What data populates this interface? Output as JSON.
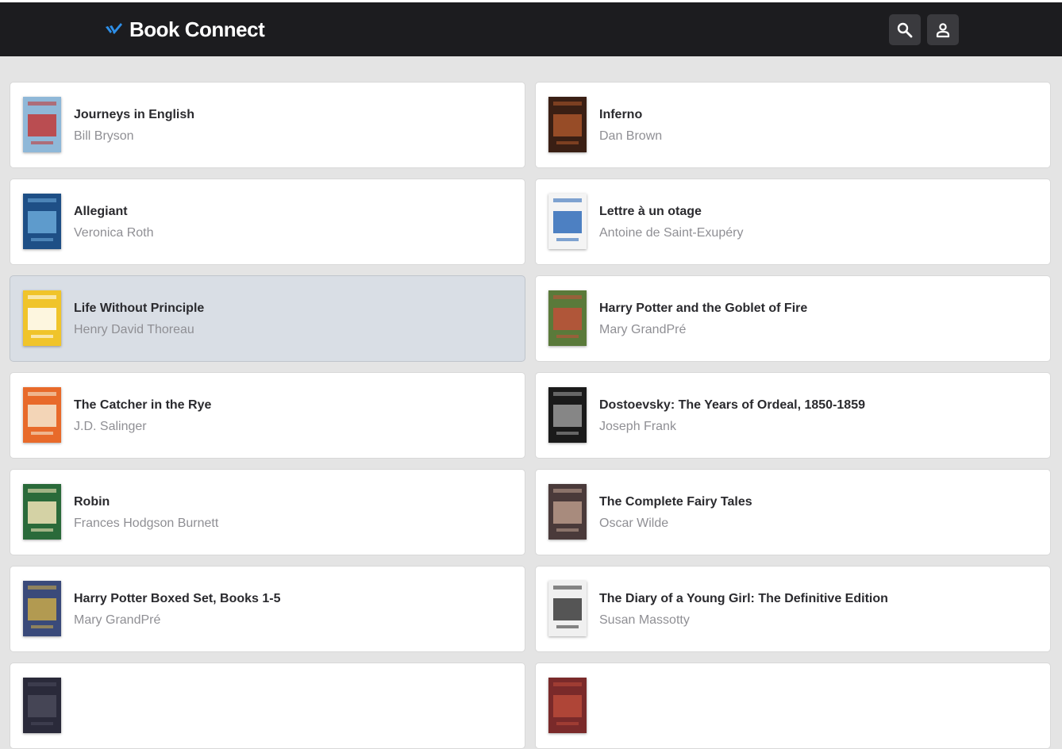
{
  "header": {
    "app_name": "Book Connect",
    "brand_color": "#1c1c1f",
    "logo_color": "#2e8fe8",
    "search_icon": "search-icon",
    "account_icon": "account-icon"
  },
  "books": [
    {
      "title": "Journeys in English",
      "author": "Bill Bryson",
      "cover_colors": [
        "#8fb8d8",
        "#c23a3a"
      ]
    },
    {
      "title": "Inferno",
      "author": "Dan Brown",
      "cover_colors": [
        "#3a1f14",
        "#a8552a"
      ]
    },
    {
      "title": "Allegiant",
      "author": "Veronica Roth",
      "cover_colors": [
        "#1e4f86",
        "#6aa8d8"
      ]
    },
    {
      "title": "Lettre à un otage",
      "author": "Antoine de Saint-Exupéry",
      "cover_colors": [
        "#f4f4f4",
        "#2f6bb8"
      ]
    },
    {
      "title": "Life Without Principle",
      "author": "Henry David Thoreau",
      "cover_colors": [
        "#f0c42a",
        "#ffffff"
      ]
    },
    {
      "title": "Harry Potter and the Goblet of Fire",
      "author": "Mary GrandPré",
      "cover_colors": [
        "#5a7a3a",
        "#c0503a"
      ]
    },
    {
      "title": "The Catcher in the Rye",
      "author": "J.D. Salinger",
      "cover_colors": [
        "#e86a2a",
        "#f4e8d0"
      ]
    },
    {
      "title": "Dostoevsky: The Years of Ordeal, 1850-1859",
      "author": "Joseph Frank",
      "cover_colors": [
        "#1a1a1a",
        "#9a9a9a"
      ]
    },
    {
      "title": "Robin",
      "author": "Frances Hodgson Burnett",
      "cover_colors": [
        "#2a6a3a",
        "#f2e4b8"
      ]
    },
    {
      "title": "The Complete Fairy Tales",
      "author": "Oscar Wilde",
      "cover_colors": [
        "#4a3a3a",
        "#b89a8a"
      ]
    },
    {
      "title": "Harry Potter Boxed Set, Books 1-5",
      "author": "Mary GrandPré",
      "cover_colors": [
        "#3a4a7a",
        "#c8a84a"
      ]
    },
    {
      "title": "The Diary of a Young Girl: The Definitive Edition",
      "author": "Susan Massotty",
      "cover_colors": [
        "#f0f0f0",
        "#3a3a3a"
      ]
    },
    {
      "title": "",
      "author": "",
      "cover_colors": [
        "#2a2a3a",
        "#4a4a5a"
      ]
    },
    {
      "title": "",
      "author": "",
      "cover_colors": [
        "#7a2a2a",
        "#b84a3a"
      ]
    }
  ],
  "selected_index": 4
}
